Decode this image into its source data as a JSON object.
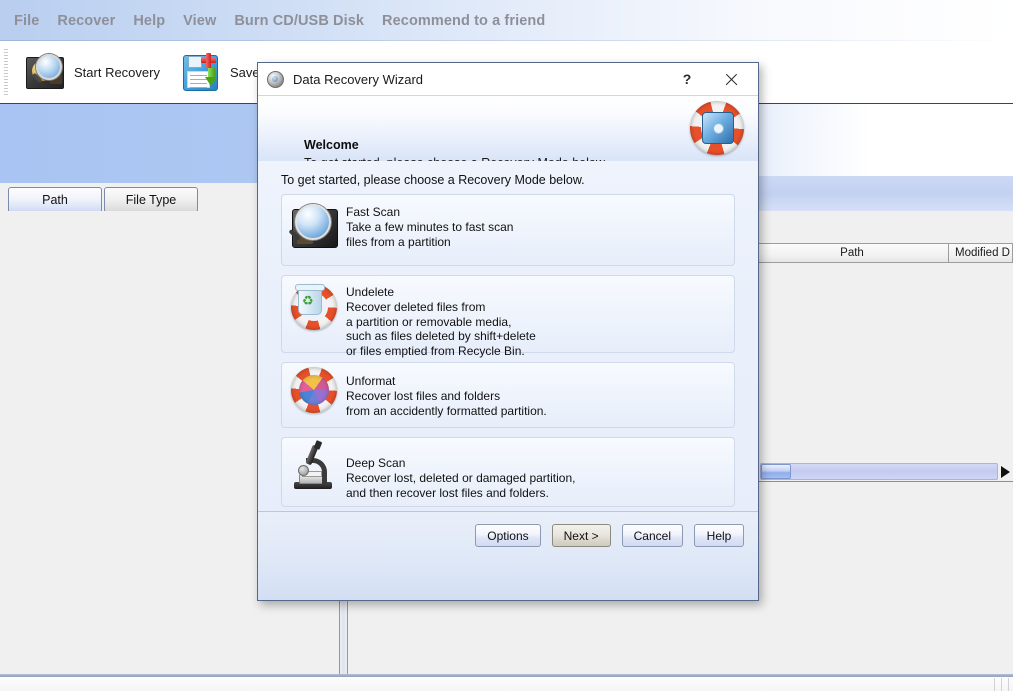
{
  "menu": {
    "items": [
      {
        "label": "File"
      },
      {
        "label": "Recover"
      },
      {
        "label": "Help"
      },
      {
        "label": "View"
      },
      {
        "label": "Burn CD/USB Disk"
      },
      {
        "label": "Recommend to a friend"
      }
    ]
  },
  "toolbar": {
    "buttons": [
      {
        "label": "Start Recovery",
        "icon": "hard-drive-magnifier-icon"
      },
      {
        "label": "Save Files",
        "icon": "save-files-icon"
      }
    ]
  },
  "tabs": [
    {
      "label": "Path",
      "active": true
    },
    {
      "label": "File Type",
      "active": false
    }
  ],
  "results_table": {
    "columns": [
      "Path",
      "Modified D"
    ]
  },
  "scrollbar": {
    "arrow_right": "scroll-right-arrow"
  },
  "dialog": {
    "title": "Data Recovery Wizard",
    "title_buttons": {
      "help": "?",
      "close": "✕"
    },
    "header": {
      "heading": "Welcome",
      "subtitle": "To get started, please choose a Recovery Mode below.",
      "icon": "life-ring-disk-icon"
    },
    "body": {
      "instruction": "To get started, please choose a Recovery Mode below.",
      "modes": [
        {
          "id": "fast-scan",
          "title": "Fast Scan",
          "description": "Take a few minutes to fast scan\nfiles from a partition",
          "icon": "hard-drive-magnifier-icon"
        },
        {
          "id": "undelete",
          "title": "Undelete",
          "description": "Recover deleted files from\na partition or removable media,\nsuch as files deleted by shift+delete\nor files emptied from Recycle Bin.",
          "icon": "recycle-bin-life-ring-icon"
        },
        {
          "id": "unformat",
          "title": "Unformat",
          "description": "Recover lost files and folders\nfrom an accidently formatted partition.",
          "icon": "color-wheel-life-ring-icon"
        },
        {
          "id": "deep-scan",
          "title": "Deep Scan",
          "description": "Recover lost, deleted or damaged partition,\nand then recover lost files and folders.",
          "icon": "microscope-icon"
        }
      ]
    },
    "footer": {
      "buttons": [
        {
          "id": "options",
          "label": "Options",
          "focused": false
        },
        {
          "id": "next",
          "label": "Next >",
          "focused": true
        },
        {
          "id": "cancel",
          "label": "Cancel",
          "focused": false
        },
        {
          "id": "help",
          "label": "Help",
          "focused": false
        }
      ]
    }
  },
  "colors": {
    "menu_text": "#8e9099",
    "banner_blue": "#a9c4f2",
    "dialog_border": "#55688a",
    "accent_orange": "#e8502a"
  }
}
